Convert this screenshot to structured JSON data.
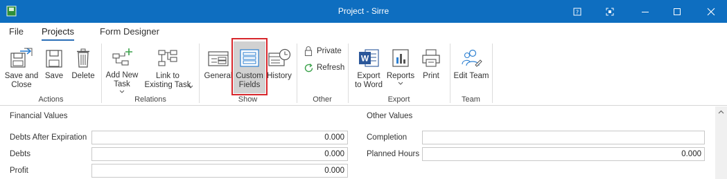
{
  "window": {
    "title": "Project - Sirre",
    "controls": [
      "help-icon",
      "restore-size-icon",
      "minimize-icon",
      "maximize-icon",
      "close-icon"
    ]
  },
  "menu": {
    "tabs": [
      {
        "label": "File"
      },
      {
        "label": "Projects",
        "active": true
      },
      {
        "label": "Form Designer"
      }
    ]
  },
  "ribbon": {
    "groups": {
      "actions": "Actions",
      "relations": "Relations",
      "show": "Show",
      "other": "Other",
      "export": "Export",
      "team": "Team"
    },
    "buttons": {
      "save_and_close": "Save and\nClose",
      "save": "Save",
      "delete": "Delete",
      "add_new_task": "Add New\nTask",
      "link_existing_task": "Link to\nExisting Task",
      "general": "General",
      "custom_fields": "Custom\nFields",
      "history": "History",
      "private": "Private",
      "refresh": "Refresh",
      "export_to_word": "Export\nto Word",
      "reports": "Reports",
      "print": "Print",
      "edit_team": "Edit Team"
    },
    "selected": "custom_fields",
    "highlight_color": "#d7262b"
  },
  "content": {
    "financial": {
      "title": "Financial Values",
      "fields": [
        {
          "label": "Debts After Expiration",
          "value": "0.000"
        },
        {
          "label": "Debts",
          "value": "0.000"
        },
        {
          "label": "Profit",
          "value": "0.000"
        }
      ]
    },
    "other": {
      "title": "Other Values",
      "fields": [
        {
          "label": "Completion",
          "value": ""
        },
        {
          "label": "Planned Hours",
          "value": "0.000"
        }
      ]
    }
  },
  "colors": {
    "titlebar": "#0e6ec0",
    "accent": "#2b6fb8",
    "selected_button": "#d1d1d1"
  }
}
